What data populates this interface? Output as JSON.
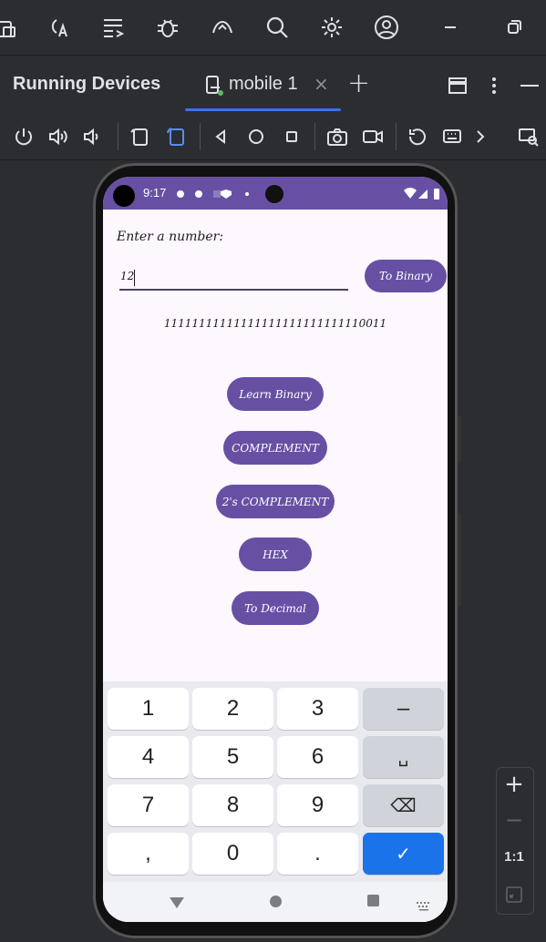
{
  "panel": {
    "title": "Running Devices"
  },
  "tab": {
    "label": "mobile 1",
    "close": "×",
    "add": "+"
  },
  "status": {
    "time": "9:17"
  },
  "app": {
    "prompt": "Enter a number:",
    "input_value": "12",
    "to_binary_label": "To Binary",
    "result": "11111111111111111111111111110011",
    "buttons": [
      "Learn Binary",
      "COMPLEMENT",
      "2's COMPLEMENT",
      "HEX",
      "To Decimal"
    ]
  },
  "keyboard": {
    "rows": [
      [
        "1",
        "2",
        "3",
        "–"
      ],
      [
        "4",
        "5",
        "6",
        "␣"
      ],
      [
        "7",
        "8",
        "9",
        "⌫"
      ],
      [
        ",",
        "0",
        ".",
        "✓"
      ]
    ]
  },
  "zoom": {
    "in": "+",
    "out": "−",
    "ratio": "1:1"
  },
  "colors": {
    "accent": "#6750a4",
    "ide_bg": "#2b2d30",
    "screen_bg": "#fdf7fe",
    "tab_underline": "#3574f0",
    "enter_key": "#1a73e8"
  }
}
